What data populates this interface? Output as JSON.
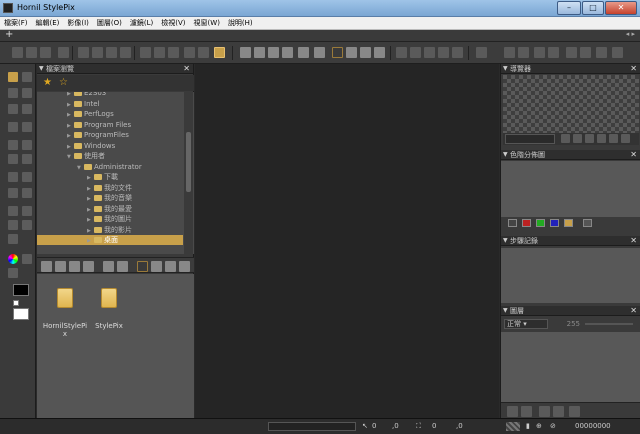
{
  "window": {
    "title": "Hornil StylePix",
    "minimize": "–",
    "maximize": "□",
    "close": "✕"
  },
  "menu": [
    "檔案(F)",
    "編輯(E)",
    "影像(I)",
    "圖層(O)",
    "濾鏡(L)",
    "檢視(V)",
    "視窗(W)",
    "說明(H)"
  ],
  "tabbar": {
    "add": "+",
    "scroll": "◂ ▸"
  },
  "file_browser": {
    "title": "檔案瀏覽",
    "tree": [
      {
        "label": "E2S03",
        "level": 1,
        "expanded": false
      },
      {
        "label": "Intel",
        "level": 1,
        "expanded": false
      },
      {
        "label": "PerfLogs",
        "level": 1,
        "expanded": false
      },
      {
        "label": "Program Files",
        "level": 1,
        "expanded": false
      },
      {
        "label": "ProgramFiles",
        "level": 1,
        "expanded": false
      },
      {
        "label": "Windows",
        "level": 1,
        "expanded": false
      },
      {
        "label": "使用者",
        "level": 1,
        "expanded": true
      },
      {
        "label": "Administrator",
        "level": 2,
        "expanded": true
      },
      {
        "label": "下載",
        "level": 3,
        "expanded": false
      },
      {
        "label": "我的文件",
        "level": 3,
        "expanded": false
      },
      {
        "label": "我的音樂",
        "level": 3,
        "expanded": false
      },
      {
        "label": "我的最愛",
        "level": 3,
        "expanded": false
      },
      {
        "label": "我的圖片",
        "level": 3,
        "expanded": false
      },
      {
        "label": "我的影片",
        "level": 3,
        "expanded": false
      },
      {
        "label": "桌面",
        "level": 3,
        "expanded": false,
        "selected": true
      }
    ],
    "files": [
      {
        "name": "HornilStylePi\nx"
      },
      {
        "name": "StylePix"
      }
    ]
  },
  "panels": {
    "navigator": "導覽器",
    "histogram": "色階分佈圖",
    "history": "步驟記錄",
    "layers": "圖層"
  },
  "layers": {
    "blend_mode": "正常",
    "opacity": "255"
  },
  "status": {
    "x": "0",
    "y": ",0",
    "code": "00000000"
  },
  "colors": {
    "accent": "#c8a04a",
    "canvas": "#252525",
    "panel": "#3a3a3a",
    "foreground": "#000000",
    "background": "#ffffff"
  }
}
